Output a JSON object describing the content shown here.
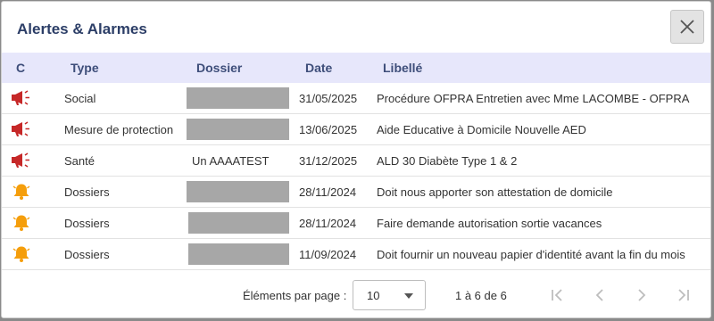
{
  "dialog": {
    "title": "Alertes & Alarmes"
  },
  "columns": {
    "c": "C",
    "type": "Type",
    "dossier": "Dossier",
    "date": "Date",
    "libelle": "Libellé"
  },
  "rows": [
    {
      "icon": "megaphone-icon",
      "type": "Social",
      "dossier": "",
      "redacted": true,
      "date": "31/05/2025",
      "libelle": "Procédure OFPRA Entretien avec Mme LACOMBE - OFPRA"
    },
    {
      "icon": "megaphone-icon",
      "type": "Mesure de protection",
      "dossier": "",
      "redacted": true,
      "date": "13/06/2025",
      "libelle": "Aide Educative à Domicile Nouvelle AED"
    },
    {
      "icon": "megaphone-icon",
      "type": "Santé",
      "dossier": "Un AAAATEST",
      "redacted": false,
      "date": "31/12/2025",
      "libelle": "ALD 30 Diabète Type 1 & 2"
    },
    {
      "icon": "bell-icon",
      "type": "Dossiers",
      "dossier": "",
      "redacted": true,
      "date": "28/11/2024",
      "libelle": "Doit nous apporter son attestation de domicile"
    },
    {
      "icon": "bell-icon",
      "type": "Dossiers",
      "dossier": "",
      "redacted": true,
      "date": "28/11/2024",
      "libelle": "Faire demande autorisation sortie vacances"
    },
    {
      "icon": "bell-icon",
      "type": "Dossiers",
      "dossier": "",
      "redacted": true,
      "date": "11/09/2024",
      "libelle": "Doit fournir un nouveau papier d'identité avant la fin du mois"
    }
  ],
  "paginator": {
    "items_per_page_label": "Éléments par page :",
    "page_size": "10",
    "range": "1 à 6 de 6"
  },
  "colors": {
    "header_bg": "#e7e7fb",
    "header_text": "#3e4e7a",
    "title": "#2c3e67",
    "alarm_red": "#c62828",
    "bell_orange": "#f59e0b",
    "redaction_gray": "#a7a7a7"
  }
}
